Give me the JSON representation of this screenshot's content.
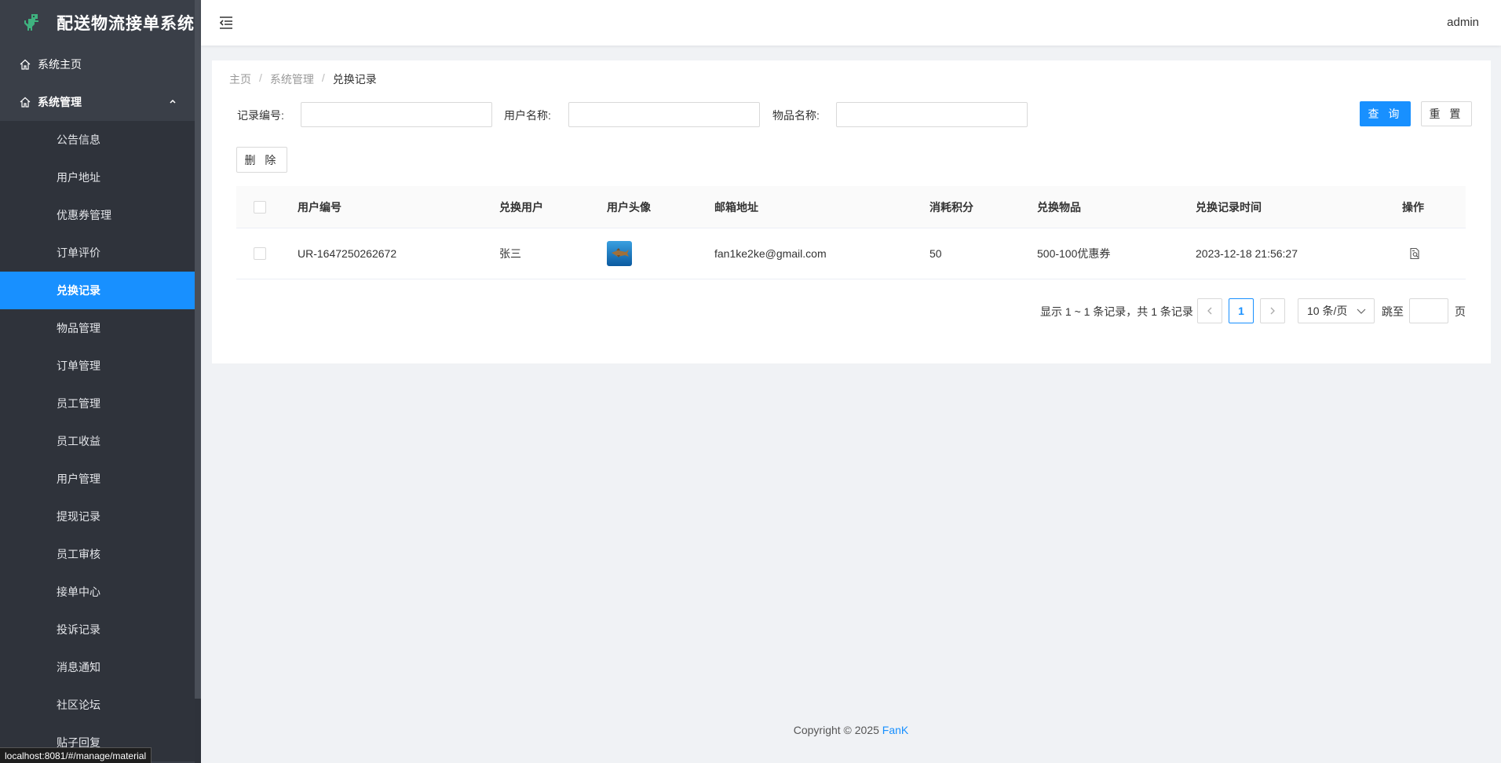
{
  "app": {
    "title": "配送物流接单系统",
    "user": "admin"
  },
  "sidebar": {
    "home": "系统主页",
    "group": "系统管理",
    "items": [
      {
        "label": "公告信息",
        "active": false
      },
      {
        "label": "用户地址",
        "active": false
      },
      {
        "label": "优惠券管理",
        "active": false
      },
      {
        "label": "订单评价",
        "active": false
      },
      {
        "label": "兑换记录",
        "active": true
      },
      {
        "label": "物品管理",
        "active": false
      },
      {
        "label": "订单管理",
        "active": false
      },
      {
        "label": "员工管理",
        "active": false
      },
      {
        "label": "员工收益",
        "active": false
      },
      {
        "label": "用户管理",
        "active": false
      },
      {
        "label": "提现记录",
        "active": false
      },
      {
        "label": "员工审核",
        "active": false
      },
      {
        "label": "接单中心",
        "active": false
      },
      {
        "label": "投诉记录",
        "active": false
      },
      {
        "label": "消息通知",
        "active": false
      },
      {
        "label": "社区论坛",
        "active": false
      },
      {
        "label": "贴子回复",
        "active": false
      }
    ]
  },
  "status_bar": "localhost:8081/#/manage/material",
  "breadcrumb": {
    "home": "主页",
    "section": "系统管理",
    "current": "兑换记录",
    "sep": "/"
  },
  "filters": {
    "record_no_label": "记录编号:",
    "record_no_value": "",
    "user_name_label": "用户名称:",
    "user_name_value": "",
    "item_name_label": "物品名称:",
    "item_name_value": "",
    "query_label": "查 询",
    "reset_label": "重 置"
  },
  "actions": {
    "delete_label": "删 除"
  },
  "table": {
    "columns": [
      "用户编号",
      "兑换用户",
      "用户头像",
      "邮箱地址",
      "消耗积分",
      "兑换物品",
      "兑换记录时间",
      "操作"
    ],
    "rows": [
      {
        "user_no": "UR-1647250262672",
        "user": "张三",
        "email": "fan1ke2ke@gmail.com",
        "points": "50",
        "item": "500-100优惠券",
        "time": "2023-12-18 21:56:27"
      }
    ]
  },
  "pagination": {
    "total_text": "显示 1 ~ 1 条记录，共 1 条记录",
    "current_page": "1",
    "page_size": "10 条/页",
    "jump_label": "跳至",
    "page_suffix": "页"
  },
  "footer": {
    "copyright": "Copyright © 2025 ",
    "brand": "FanK"
  },
  "colors": {
    "accent": "#1890ff",
    "sidebar": "#3a3f48",
    "submenu": "#2f333b"
  }
}
